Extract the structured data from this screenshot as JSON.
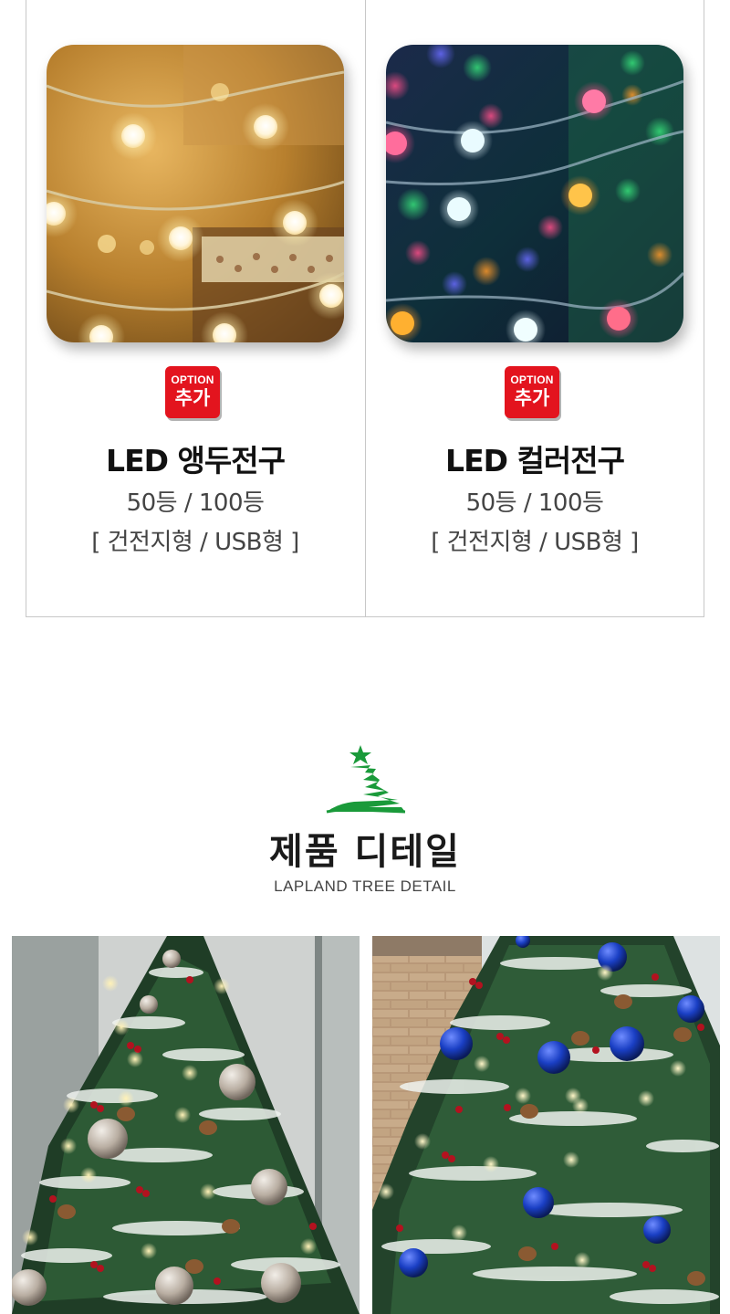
{
  "options": [
    {
      "badge_top": "OPTION",
      "badge_bottom": "추가",
      "title": "LED 앵두전구",
      "spec_line1": "50등 / 100등",
      "spec_line2": "[ 건전지형 / USB형 ]",
      "photo": "warm-white-ball-string-lights"
    },
    {
      "badge_top": "OPTION",
      "badge_bottom": "추가",
      "title": "LED 컬러전구",
      "spec_line1": "50등 / 100등",
      "spec_line2": "[ 건전지형 / USB형 ]",
      "photo": "multicolor-ball-string-lights"
    }
  ],
  "detail_section": {
    "icon": "christmas-tree-icon",
    "title": "제품 디테일",
    "subtitle": "LAPLAND TREE DETAIL"
  },
  "detail_photos": [
    {
      "subject": "snowy-tree-silver-ornaments"
    },
    {
      "subject": "snowy-tree-blue-ornaments"
    }
  ],
  "colors": {
    "badge_red": "#e3141e",
    "tree_green": "#1a9a3a",
    "border": "#c8c8c8"
  }
}
